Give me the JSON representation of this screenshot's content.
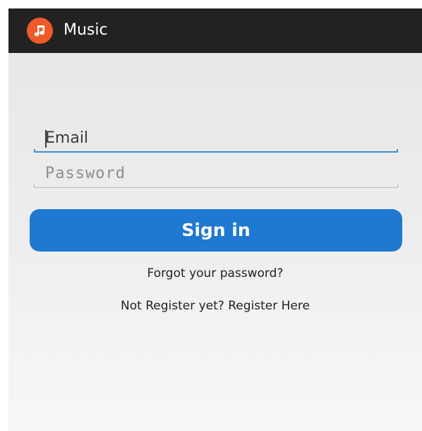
{
  "app": {
    "title": "Music",
    "icon": "music-note-icon",
    "accent_color": "#ef5a28",
    "action_bar_color": "#222222"
  },
  "login_form": {
    "email": {
      "value": "Email",
      "placeholder": "Email",
      "focused": true,
      "underline_color": "#3a8fd8"
    },
    "password": {
      "value": "",
      "placeholder": "Password"
    },
    "sign_in_label": "Sign in",
    "sign_in_color": "#1f78d1",
    "forgot_password_label": "Forgot your password?",
    "register_label": "Not Register yet? Register Here"
  }
}
